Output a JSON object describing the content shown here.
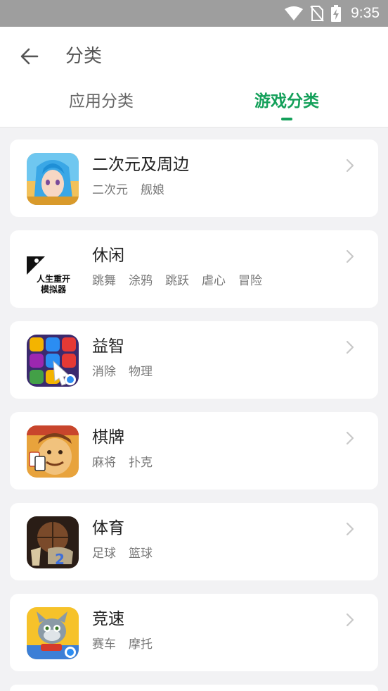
{
  "status_bar": {
    "time": "9:35"
  },
  "header": {
    "title": "分类"
  },
  "tabs": [
    {
      "label": "应用分类",
      "active": false
    },
    {
      "label": "游戏分类",
      "active": true
    }
  ],
  "categories": [
    {
      "title": "二次元及周边",
      "tags": [
        "二次元",
        "舰娘"
      ],
      "icon": "anime-game-icon"
    },
    {
      "title": "休闲",
      "tags": [
        "跳舞",
        "涂鸦",
        "跳跃",
        "虐心",
        "冒险"
      ],
      "icon": "life-simulator-icon",
      "icon_text": [
        "人生重开",
        "模拟器"
      ]
    },
    {
      "title": "益智",
      "tags": [
        "消除",
        "物理"
      ],
      "icon": "puzzle-gems-icon"
    },
    {
      "title": "棋牌",
      "tags": [
        "麻将",
        "扑克"
      ],
      "icon": "card-player-icon"
    },
    {
      "title": "体育",
      "tags": [
        "足球",
        "篮球"
      ],
      "icon": "basketball-game-icon"
    },
    {
      "title": "竞速",
      "tags": [
        "赛车",
        "摩托"
      ],
      "icon": "talking-tom-racing-icon"
    }
  ],
  "colors": {
    "accent": "#14a05a",
    "status_bar": "#9e9e9e",
    "background": "#f2f2f4"
  }
}
